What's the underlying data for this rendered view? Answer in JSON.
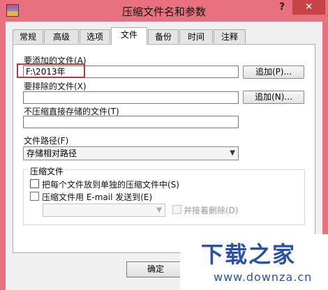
{
  "window": {
    "title": "压缩文件名和参数",
    "help": "?",
    "close": "✕"
  },
  "tabs": [
    {
      "label": "常规"
    },
    {
      "label": "高级"
    },
    {
      "label": "选项"
    },
    {
      "label": "文件"
    },
    {
      "label": "备份"
    },
    {
      "label": "时间"
    },
    {
      "label": "注释"
    }
  ],
  "active_tab": "文件",
  "files": {
    "add_label": "要添加的文件(A)",
    "add_value": "F:\\2013年",
    "add_button": "追加(P)...",
    "exclude_label": "要排除的文件(X)",
    "exclude_value": "",
    "exclude_button": "追加(N)...",
    "store_label": "不压缩直接存储的文件(T)",
    "store_value": ""
  },
  "path": {
    "label": "文件路径(F)",
    "selected": "存储相对路径"
  },
  "archives": {
    "group_title": "压缩文件",
    "separate_label": "把每个文件放到单独的压缩文件中(S)",
    "email_label": "压缩文件用 E-mail 发送到(E)",
    "email_value": "",
    "delete_after_label": "并接着删除(D)"
  },
  "ok_button": "确定",
  "watermark": {
    "title": "下载之家",
    "url": "www.downza.cn"
  }
}
